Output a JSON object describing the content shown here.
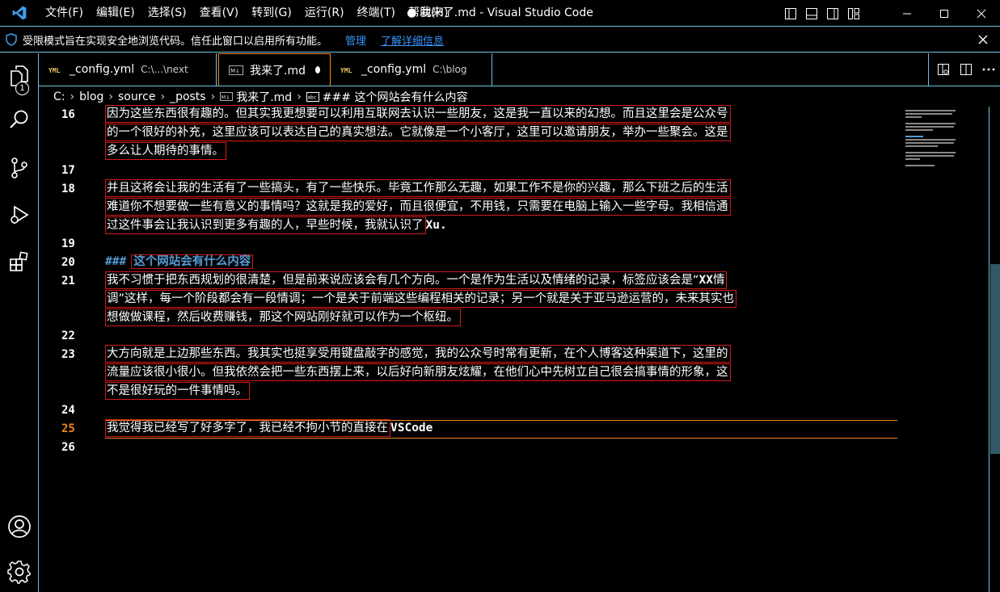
{
  "menu": [
    "文件(F)",
    "编辑(E)",
    "选择(S)",
    "查看(V)",
    "转到(G)",
    "运行(R)",
    "终端(T)",
    "帮助(H)"
  ],
  "window_title": "● 我来了.md - Visual Studio Code",
  "banner": {
    "message": "受限模式旨在实现安全地浏览代码。信任此窗口以启用所有功能。",
    "manage": "管理",
    "learn_more": "了解详细信息"
  },
  "activity": {
    "explorer_badge": "1"
  },
  "tabs": [
    {
      "label": "_config.yml",
      "desc": "C:\\...\\next"
    },
    {
      "label": "我来了.md",
      "desc": ""
    },
    {
      "label": "_config.yml",
      "desc": "C:\\blog"
    }
  ],
  "tab_icons": {
    "yml": "YML",
    "md": "M↓"
  },
  "breadcrumb": {
    "items": [
      "C:",
      "blog",
      "source",
      "_posts",
      "我来了.md",
      "### 这个网站会有什么内容"
    ],
    "symbol_icon": "abc"
  },
  "editor": {
    "line_numbers": [
      "16",
      "17",
      "18",
      "19",
      "20",
      "21",
      "22",
      "23",
      "24",
      "25",
      "26"
    ],
    "current_line": "25",
    "l16": [
      "因为这些东西很有趣的。但其实我更想要可以利用互联网去认识一些朋友，这是我一直以来的幻想。而且这里会是公众号",
      "的一个很好的补充，这里应该可以表达自己的真实想法。它就像是一个小客厅，这里可以邀请朋友，举办一些聚会。这是",
      "多么让人期待的事情。"
    ],
    "l18": [
      "并且这将会让我的生活有了一些搞头，有了一些快乐。毕竟工作那么无趣，如果工作不是你的兴趣，那么下班之后的生活",
      "难道你不想要做一些有意义的事情吗？这就是我的爱好，而且很便宜，不用钱，只需要在电脑上输入一些字母。我相信通",
      "过这件事会让我认识到更多有趣的人，早些时候，我就认识了"
    ],
    "l18_tail": "Xu.",
    "l20_hash": "###",
    "l20_text": "这个网站会有什么内容",
    "l21": [
      "我不习惯于把东西规划的很清楚，但是前来说应该会有几个方向。一个是作为生活以及情绪的记录，标签应该会是“",
      "调”这样，每一个阶段都会有一段情调；一个是关于前端这些编程相关的记录；另一个就是关于亚马逊运营的，未来其实也",
      "想做做课程，然后收费赚钱，那这个网站刚好就可以作为一个枢纽。"
    ],
    "l21_xx": "XX",
    "l21_qing": "情",
    "l23": [
      "大方向就是上边那些东西。我其实也挺享受用键盘敲字的感觉，我的公众号时常有更新，在个人博客这种渠道下，这里的",
      "流量应该很小很小。但我依然会把一些东西摆上来，以后好向新朋友炫耀，在他们心中先树立自己很会搞事情的形象，这",
      "不是很好玩的一件事情吗。"
    ],
    "l25": "我觉得我已经写了好多字了，我已经不拘小节的直接在",
    "l25_tail": "VSCode"
  },
  "colors": {
    "accent": "#6fc3df",
    "active_border": "#f38518",
    "highlight_border": "#d41919",
    "link": "#3794ff",
    "heading": "#569cd6"
  }
}
